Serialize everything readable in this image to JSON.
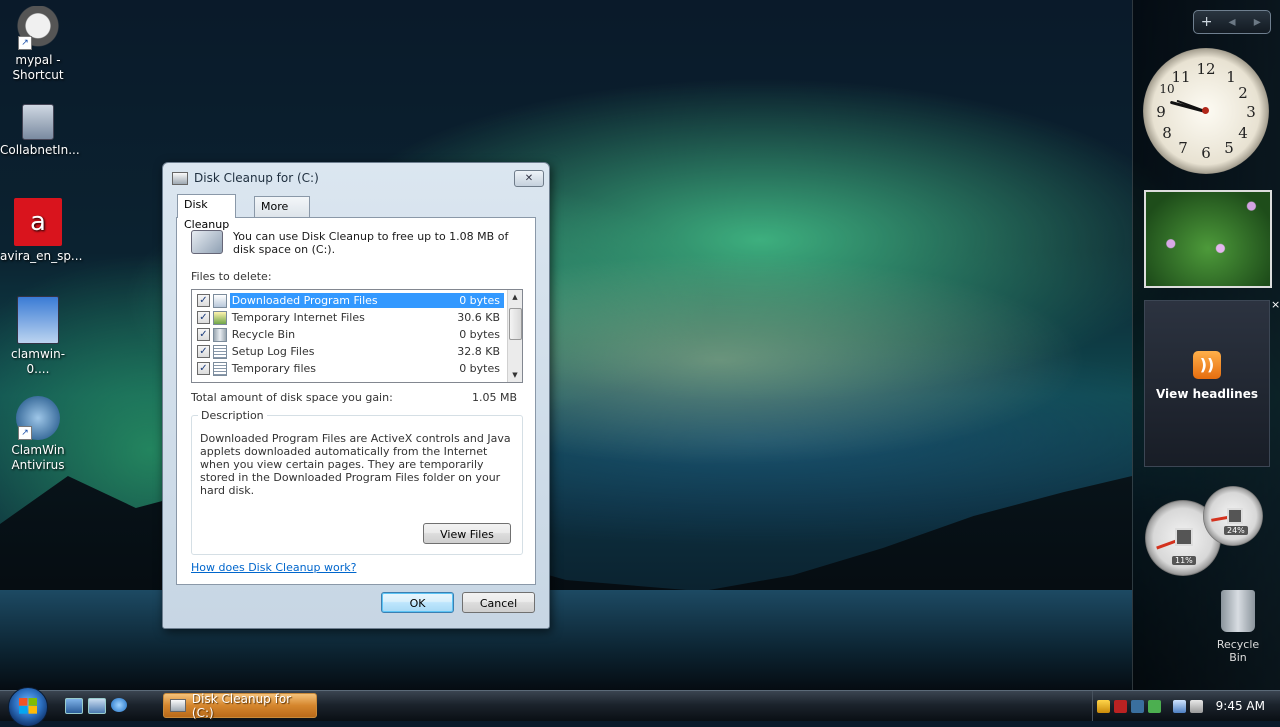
{
  "desktop": {
    "icons": [
      {
        "label": "mypal - Shortcut"
      },
      {
        "label": "CollabnetIn..."
      },
      {
        "label": "avira_en_sp..."
      },
      {
        "label": "clamwin-0...."
      },
      {
        "label": "ClamWin Antivirus"
      }
    ]
  },
  "sidebar": {
    "controls": {
      "add": "+",
      "prev": "◂",
      "next": "▸"
    },
    "clock": {
      "numbers": [
        "12",
        "1",
        "2",
        "3",
        "4",
        "5",
        "6",
        "7",
        "8",
        "9",
        "10",
        "11"
      ]
    },
    "feed": {
      "label": "View headlines",
      "close": "×",
      "icon": "rss-icon"
    },
    "meters": {
      "cpu": "11%",
      "memory": "24%"
    },
    "recycle_bin": "Recycle Bin"
  },
  "dialog": {
    "title": "Disk Cleanup for  (C:)",
    "close_label": "✕",
    "tabs": [
      "Disk Cleanup",
      "More Options"
    ],
    "intro": "You can use Disk Cleanup to free up to 1.08 MB of disk space on  (C:).",
    "files_label": "Files to delete:",
    "files": [
      {
        "name": "Downloaded Program Files",
        "size": "0 bytes",
        "checked": true
      },
      {
        "name": "Temporary Internet Files",
        "size": "30.6 KB",
        "checked": true
      },
      {
        "name": "Recycle Bin",
        "size": "0 bytes",
        "checked": true
      },
      {
        "name": "Setup Log Files",
        "size": "32.8 KB",
        "checked": true
      },
      {
        "name": "Temporary files",
        "size": "0 bytes",
        "checked": true
      }
    ],
    "total_label": "Total amount of disk space you gain:",
    "total_value": "1.05 MB",
    "description_label": "Description",
    "description": "Downloaded Program Files are ActiveX controls and Java applets downloaded automatically from the Internet when you view certain pages. They are temporarily stored in the Downloaded Program Files folder on your hard disk.",
    "view_files": "View Files",
    "help_link": "How does Disk Cleanup work?",
    "ok": "OK",
    "cancel": "Cancel"
  },
  "taskbar": {
    "task": "Disk Cleanup for  (C:)",
    "time": "9:45 AM"
  }
}
